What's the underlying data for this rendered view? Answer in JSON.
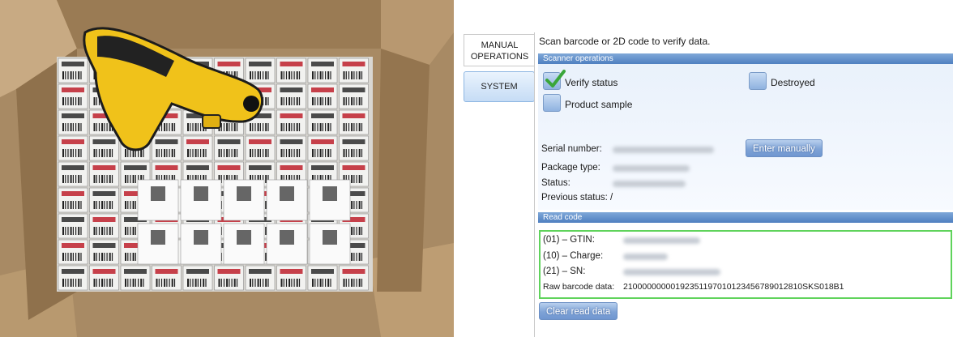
{
  "photo": {
    "description_icon": "barcode-scanner-photo"
  },
  "nav": {
    "manual_line1": "MANUAL",
    "manual_line2": "OPERATIONS",
    "system": "SYSTEM"
  },
  "instruction": "Scan barcode or 2D code to verify data.",
  "scanner": {
    "title": "Scanner operations",
    "verify_status": "Verify status",
    "destroyed": "Destroyed",
    "product_sample": "Product sample",
    "serial_label": "Serial number:",
    "package_label": "Package type:",
    "status_label": "Status:",
    "previous_status_label": "Previous status: /",
    "enter_manually": "Enter manually",
    "verify_checked": true
  },
  "read_code": {
    "title": "Read code",
    "gtin_label": "(01) – GTIN:",
    "charge_label": "(10) – Charge:",
    "sn_label": "(21) – SN:",
    "raw_label": "Raw barcode data:",
    "raw_value": "21000000000192351197010123456789012810SKS018B1",
    "clear_button": "Clear read data"
  },
  "colors": {
    "group_bar": "#5f8cc8",
    "read_border": "#5fd35b",
    "check_green": "#3aa63a"
  }
}
